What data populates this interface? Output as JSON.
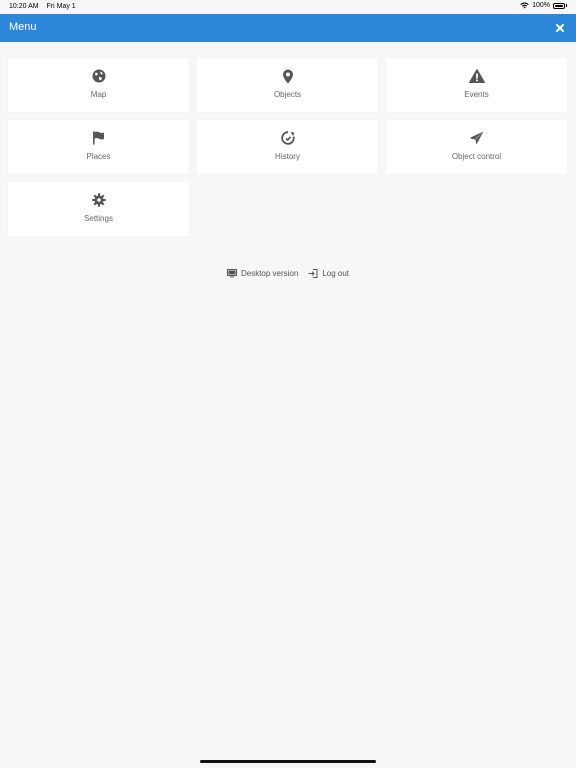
{
  "status_bar": {
    "time": "10:20 AM",
    "date": "Fri May 1",
    "battery": "100%"
  },
  "header": {
    "title": "Menu"
  },
  "menu": [
    {
      "label": "Map",
      "icon": "globe-icon"
    },
    {
      "label": "Objects",
      "icon": "location-pin-icon"
    },
    {
      "label": "Events",
      "icon": "warning-icon"
    },
    {
      "label": "Places",
      "icon": "flag-icon"
    },
    {
      "label": "History",
      "icon": "history-icon"
    },
    {
      "label": "Object control",
      "icon": "paper-plane-icon"
    },
    {
      "label": "Settings",
      "icon": "gear-icon"
    }
  ],
  "links": {
    "desktop": "Desktop version",
    "logout": "Log out"
  },
  "colors": {
    "header": "#2d87d8",
    "background": "#f7f7f7",
    "icon": "#555555"
  }
}
